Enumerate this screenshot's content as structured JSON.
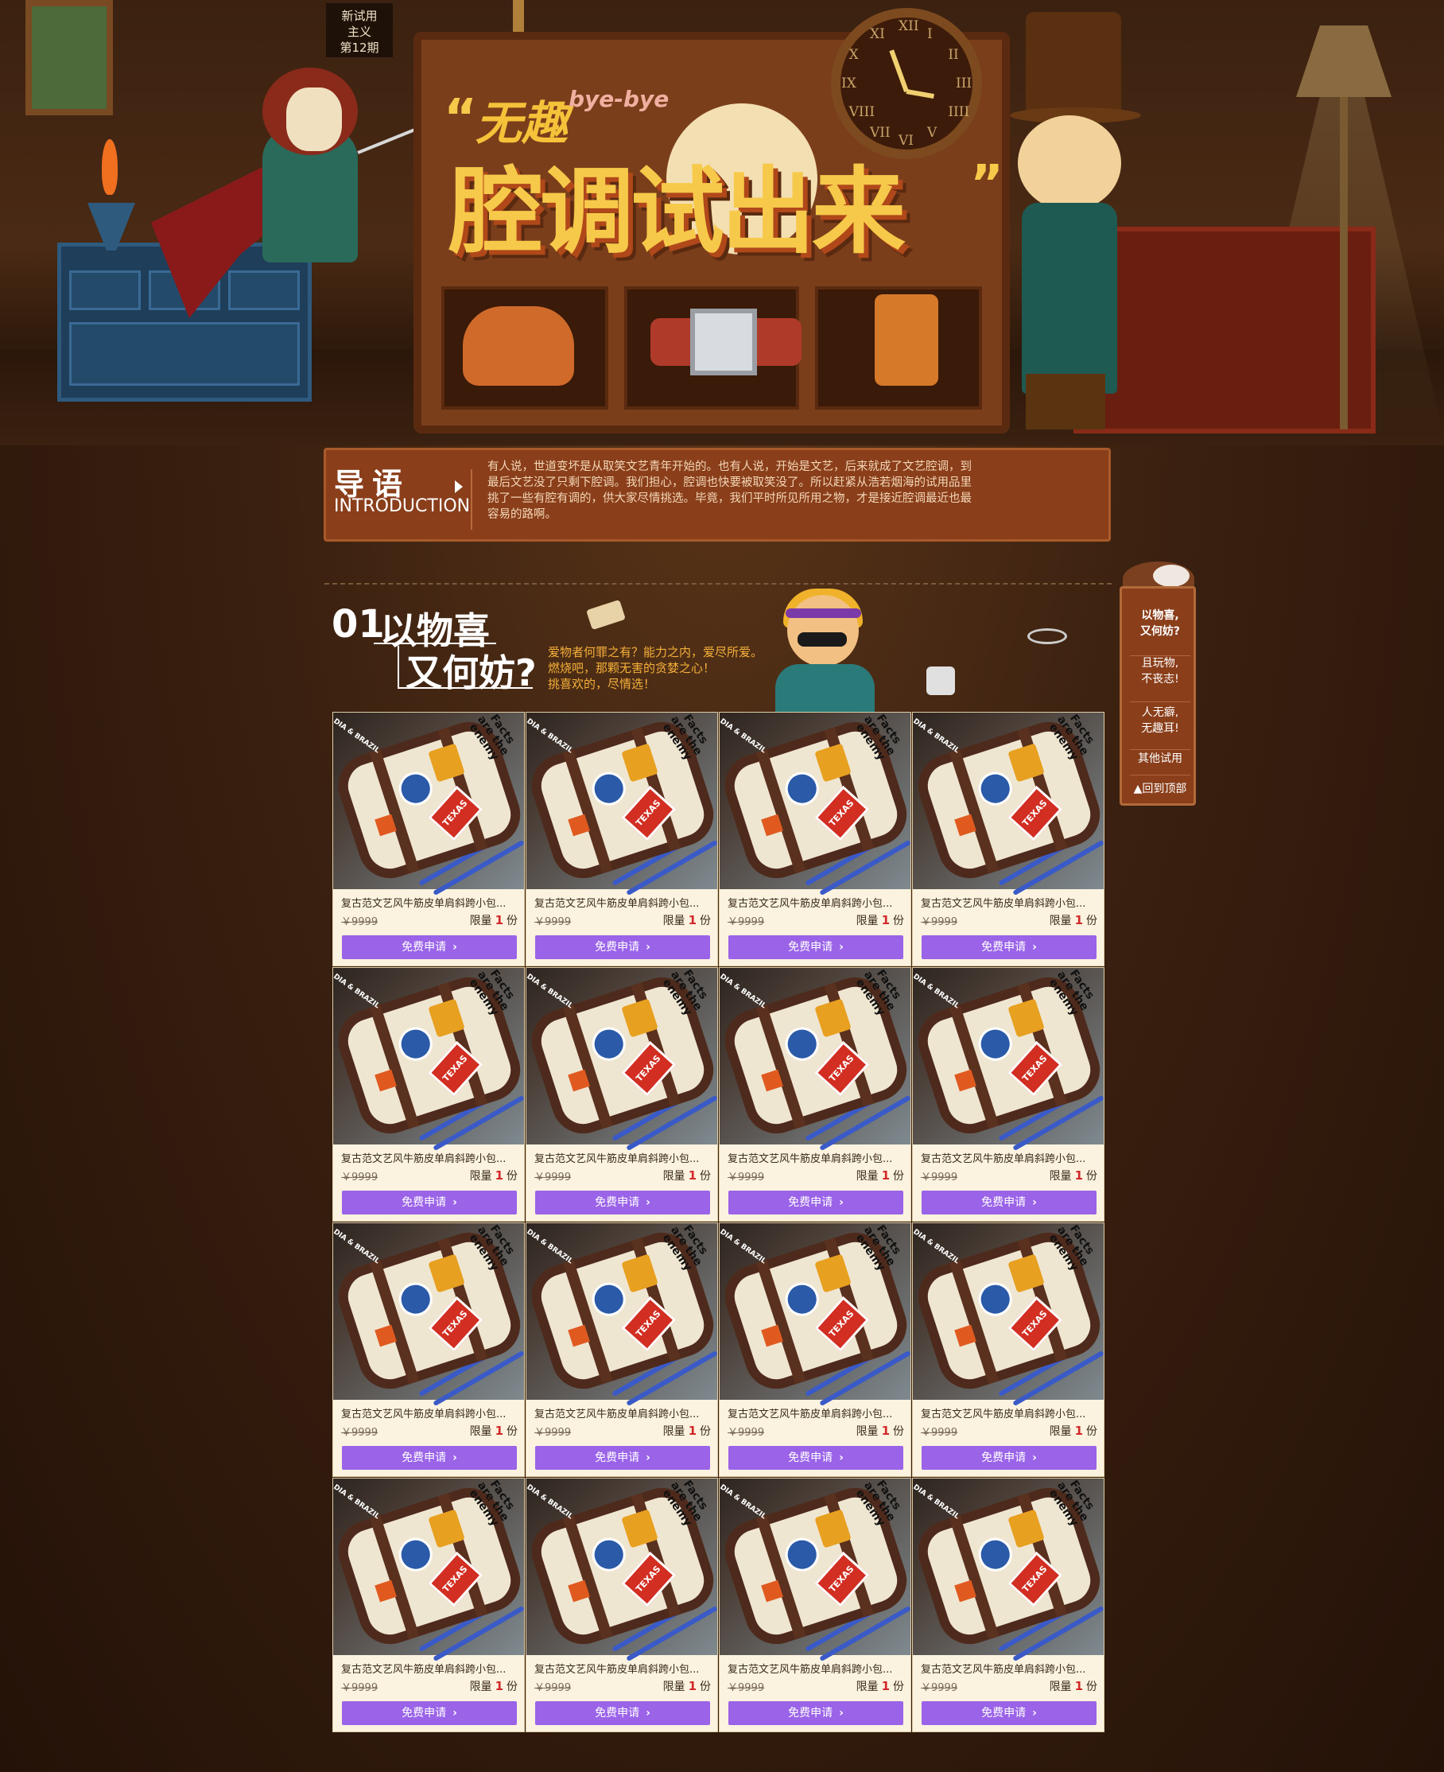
{
  "issue_badge": {
    "line1": "新试用",
    "line2": "主义",
    "line3": "第12期"
  },
  "banner": {
    "quote_open": "“",
    "wuqu": "无趣",
    "byebye": "bye-bye",
    "title": "腔调试出来",
    "quote_close": "”",
    "clock_numerals": [
      "XII",
      "I",
      "II",
      "III",
      "IIII",
      "V",
      "VI",
      "VII",
      "VIII",
      "IX",
      "X",
      "XI"
    ]
  },
  "intro": {
    "title": "导语",
    "subtitle": "INTRODUCTION",
    "text": "有人说，世道变坏是从取笑文艺青年开始的。也有人说，开始是文艺，后来就成了文艺腔调，到最后文艺没了只剩下腔调。我们担心，腔调也快要被取笑没了。所以赶紧从浩若烟海的试用品里挑了一些有腔有调的，供大家尽情挑选。毕竟，我们平时所见所用之物，才是接近腔调最近也最容易的路啊。"
  },
  "section": {
    "number": "01",
    "title_line1": "以物喜",
    "title_line2": "又何妨?",
    "desc_lines": [
      "爱物者何罪之有？能力之内，爱尽所爱。",
      "燃烧吧，那颗无害的贪婪之心！",
      "挑喜欢的，尽情选！"
    ]
  },
  "products": [
    {
      "name": "复古范文艺风牛筋皮单肩斜跨小包...",
      "price": "￥9999",
      "limit_prefix": "限量",
      "limit": "1",
      "limit_suffix": "份",
      "button": "免费申请"
    },
    {
      "name": "复古范文艺风牛筋皮单肩斜跨小包...",
      "price": "￥9999",
      "limit_prefix": "限量",
      "limit": "1",
      "limit_suffix": "份",
      "button": "免费申请"
    },
    {
      "name": "复古范文艺风牛筋皮单肩斜跨小包...",
      "price": "￥9999",
      "limit_prefix": "限量",
      "limit": "1",
      "limit_suffix": "份",
      "button": "免费申请"
    },
    {
      "name": "复古范文艺风牛筋皮单肩斜跨小包...",
      "price": "￥9999",
      "limit_prefix": "限量",
      "limit": "1",
      "limit_suffix": "份",
      "button": "免费申请"
    },
    {
      "name": "复古范文艺风牛筋皮单肩斜跨小包...",
      "price": "￥9999",
      "limit_prefix": "限量",
      "limit": "1",
      "limit_suffix": "份",
      "button": "免费申请"
    },
    {
      "name": "复古范文艺风牛筋皮单肩斜跨小包...",
      "price": "￥9999",
      "limit_prefix": "限量",
      "limit": "1",
      "limit_suffix": "份",
      "button": "免费申请"
    },
    {
      "name": "复古范文艺风牛筋皮单肩斜跨小包...",
      "price": "￥9999",
      "limit_prefix": "限量",
      "limit": "1",
      "limit_suffix": "份",
      "button": "免费申请"
    },
    {
      "name": "复古范文艺风牛筋皮单肩斜跨小包...",
      "price": "￥9999",
      "limit_prefix": "限量",
      "limit": "1",
      "limit_suffix": "份",
      "button": "免费申请"
    },
    {
      "name": "复古范文艺风牛筋皮单肩斜跨小包...",
      "price": "￥9999",
      "limit_prefix": "限量",
      "limit": "1",
      "limit_suffix": "份",
      "button": "免费申请"
    },
    {
      "name": "复古范文艺风牛筋皮单肩斜跨小包...",
      "price": "￥9999",
      "limit_prefix": "限量",
      "limit": "1",
      "limit_suffix": "份",
      "button": "免费申请"
    },
    {
      "name": "复古范文艺风牛筋皮单肩斜跨小包...",
      "price": "￥9999",
      "limit_prefix": "限量",
      "limit": "1",
      "limit_suffix": "份",
      "button": "免费申请"
    },
    {
      "name": "复古范文艺风牛筋皮单肩斜跨小包...",
      "price": "￥9999",
      "limit_prefix": "限量",
      "limit": "1",
      "limit_suffix": "份",
      "button": "免费申请"
    },
    {
      "name": "复古范文艺风牛筋皮单肩斜跨小包...",
      "price": "￥9999",
      "limit_prefix": "限量",
      "limit": "1",
      "limit_suffix": "份",
      "button": "免费申请"
    },
    {
      "name": "复古范文艺风牛筋皮单肩斜跨小包...",
      "price": "￥9999",
      "limit_prefix": "限量",
      "limit": "1",
      "limit_suffix": "份",
      "button": "免费申请"
    },
    {
      "name": "复古范文艺风牛筋皮单肩斜跨小包...",
      "price": "￥9999",
      "limit_prefix": "限量",
      "limit": "1",
      "limit_suffix": "份",
      "button": "免费申请"
    },
    {
      "name": "复古范文艺风牛筋皮单肩斜跨小包...",
      "price": "￥9999",
      "limit_prefix": "限量",
      "limit": "1",
      "limit_suffix": "份",
      "button": "免费申请"
    }
  ],
  "product_image_text": {
    "corner": "DIA & BRAZIL",
    "slogan": "Facts are the enemy",
    "patch": "TEXAS"
  },
  "side_nav": {
    "items": [
      {
        "label_1": "以物喜,",
        "label_2": "又何妨?"
      },
      {
        "label_1": "且玩物,",
        "label_2": "不丧志!"
      },
      {
        "label_1": "人无癖,",
        "label_2": "无趣耳!"
      },
      {
        "label_1": "其他试用",
        "label_2": ""
      }
    ],
    "back_to_top": "▲回到顶部"
  },
  "colors": {
    "button": "#9a63e8",
    "accent_orange": "#f5b03a",
    "limit_red": "#d2282a",
    "intro_bg": "#8a3e1a"
  }
}
